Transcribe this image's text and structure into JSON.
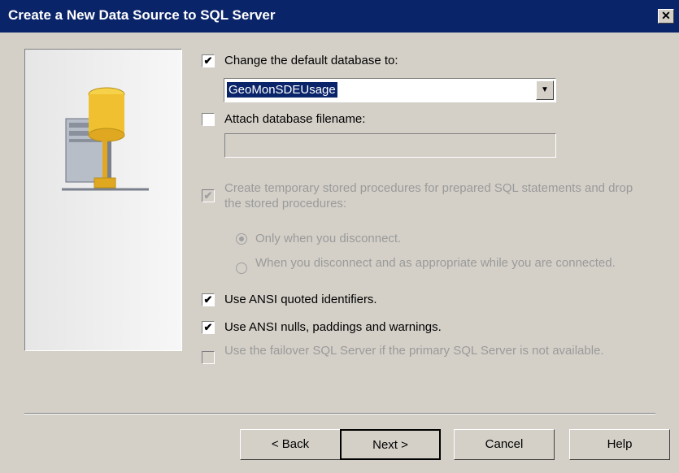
{
  "window": {
    "title": "Create a New Data Source to SQL Server",
    "close_glyph": "✕"
  },
  "options": {
    "change_default_db": {
      "label": "Change the default database to:",
      "checked": true
    },
    "database_value": "GeoMonSDEUsage",
    "attach_db": {
      "label": "Attach database filename:",
      "checked": false,
      "value": ""
    },
    "temp_procs": {
      "label": "Create temporary stored procedures for prepared SQL statements and drop the stored procedures:",
      "checked": true,
      "enabled": false
    },
    "radio_disconnect": {
      "label": "Only when you disconnect.",
      "selected": true
    },
    "radio_appropriate": {
      "label": "When you disconnect and as appropriate while you are connected.",
      "selected": false
    },
    "ansi_quoted": {
      "label": "Use ANSI quoted identifiers.",
      "checked": true
    },
    "ansi_nulls": {
      "label": "Use ANSI nulls, paddings and warnings.",
      "checked": true
    },
    "failover": {
      "label": "Use the failover SQL Server if the primary SQL Server is not available.",
      "checked": false,
      "enabled": false
    }
  },
  "buttons": {
    "back": "< Back",
    "next": "Next >",
    "cancel": "Cancel",
    "help": "Help"
  },
  "icons": {
    "check": "✔",
    "dropdown": "▼",
    "panel_icon": "database-server-icon"
  },
  "colors": {
    "titlebar": "#0a246a",
    "face": "#d4d0c8",
    "disabled_text": "#9a9a9a"
  }
}
